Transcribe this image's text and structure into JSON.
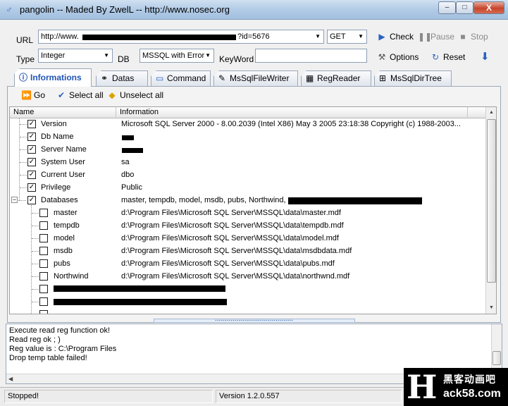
{
  "window": {
    "title": "pangolin -- Maded By ZwelL -- http://www.nosec.org",
    "controls": {
      "minimize": "–",
      "maximize": "□",
      "close": "X"
    }
  },
  "form": {
    "url_label": "URL",
    "url_prefix": "http://www.",
    "url_suffix": "?id=5676",
    "method": "GET",
    "type_label": "Type",
    "type_value": "Integer",
    "db_label": "DB",
    "db_value": "MSSQL with Error",
    "keyword_label": "KeyWord",
    "keyword_value": ""
  },
  "toolbar": {
    "check": "Check",
    "pause": "Pause",
    "stop": "Stop",
    "options": "Options",
    "reset": "Reset"
  },
  "tabs": [
    {
      "label": "Informations",
      "icon": "info-icon",
      "active": true
    },
    {
      "label": "Datas",
      "icon": "binoculars-icon"
    },
    {
      "label": "Command",
      "icon": "monitor-icon"
    },
    {
      "label": "MsSqlFileWriter",
      "icon": "file-writer-icon"
    },
    {
      "label": "RegReader",
      "icon": "registry-icon"
    },
    {
      "label": "MsSqlDirTree",
      "icon": "dir-tree-icon"
    }
  ],
  "panel_toolbar": {
    "go": "Go",
    "select_all": "Select all",
    "unselect_all": "Unselect all"
  },
  "grid": {
    "col_name": "Name",
    "col_info": "Information",
    "rows": [
      {
        "name": "Version",
        "info": "Microsoft SQL Server  2000 - 8.00.2039 (Intel X86) May  3 2005 23:18:38 Copyright (c) 1988-2003...",
        "checked": true
      },
      {
        "name": "Db Name",
        "info": "",
        "checked": true
      },
      {
        "name": "Server Name",
        "info": "",
        "checked": true
      },
      {
        "name": "System User",
        "info": "sa",
        "checked": true
      },
      {
        "name": "Current User",
        "info": "dbo",
        "checked": true
      },
      {
        "name": "Privilege",
        "info": "Public",
        "checked": true
      },
      {
        "name": "Databases",
        "info": "master, tempdb, model, msdb, pubs, Northwind,",
        "checked": true
      },
      {
        "name": "master",
        "info": "d:\\Program Files\\Microsoft SQL Server\\MSSQL\\data\\master.mdf",
        "checked": false
      },
      {
        "name": "tempdb",
        "info": "d:\\Program Files\\Microsoft SQL Server\\MSSQL\\data\\tempdb.mdf",
        "checked": false
      },
      {
        "name": "model",
        "info": "d:\\Program Files\\Microsoft SQL Server\\MSSQL\\data\\model.mdf",
        "checked": false
      },
      {
        "name": "msdb",
        "info": "d:\\Program Files\\Microsoft SQL Server\\MSSQL\\data\\msdbdata.mdf",
        "checked": false
      },
      {
        "name": "pubs",
        "info": "d:\\Program Files\\Microsoft SQL Server\\MSSQL\\data\\pubs.mdf",
        "checked": false
      },
      {
        "name": "Northwind",
        "info": "d:\\Program Files\\Microsoft SQL Server\\MSSQL\\data\\northwnd.mdf",
        "checked": false
      }
    ]
  },
  "log": [
    "Execute read reg function ok!",
    "Read reg ok ; )",
    "Reg value is : C:\\Program Files",
    "Drop temp table failed!"
  ],
  "status": {
    "state": "Stopped!",
    "version": "Version  1.2.0.557"
  },
  "watermark": {
    "letter": "H",
    "cn": "黑客动画吧",
    "url": "ack58.com"
  },
  "colors": {
    "accent": "#2153b4",
    "titlebar": "#b2cbe6",
    "close": "#c7452c"
  }
}
